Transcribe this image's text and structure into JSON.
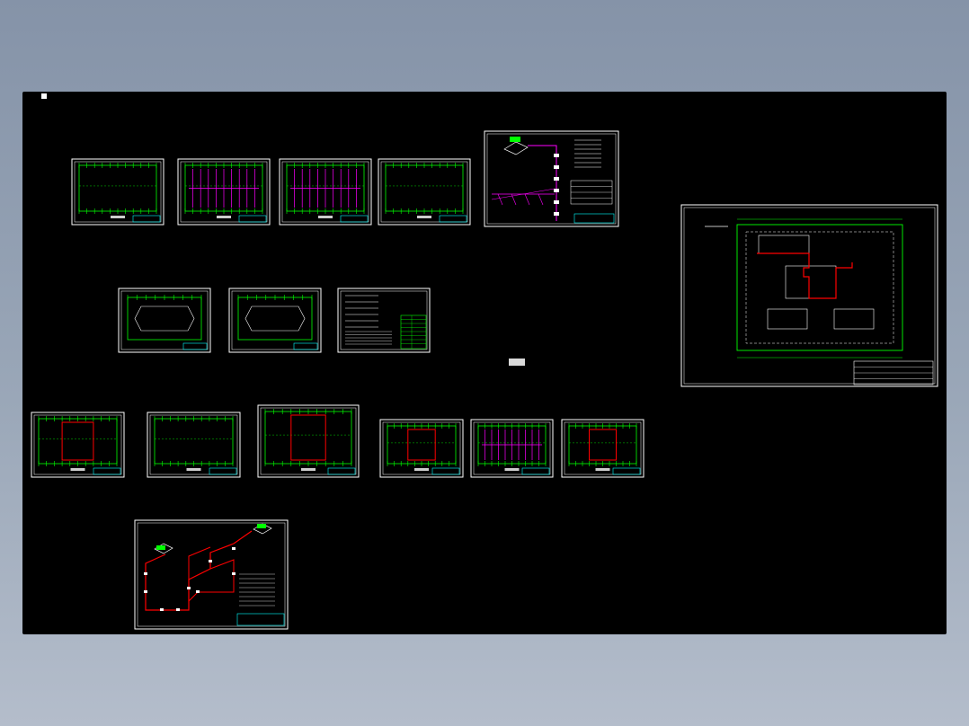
{
  "colors": {
    "background_gradient_top": "#8593a8",
    "viewport_background": "#000000",
    "frame": "#ffffff",
    "grid": "#00ff00",
    "pipe_red": "#ff0000",
    "pipe_magenta": "#ff00ff",
    "title_block": "#00ffff"
  },
  "sheets": [
    {
      "id": "floor-plan-1",
      "kind": "plan",
      "pipe": "none"
    },
    {
      "id": "floor-plan-2",
      "kind": "plan",
      "pipe": "magenta"
    },
    {
      "id": "floor-plan-3",
      "kind": "plan",
      "pipe": "magenta"
    },
    {
      "id": "floor-plan-4",
      "kind": "plan",
      "pipe": "none"
    },
    {
      "id": "system-diagram",
      "kind": "schematic",
      "pipe": "magenta"
    },
    {
      "id": "roof-plan-1",
      "kind": "roof",
      "pipe": "none"
    },
    {
      "id": "roof-plan-2",
      "kind": "roof",
      "pipe": "none"
    },
    {
      "id": "legend-sheet",
      "kind": "notes",
      "pipe": "none"
    },
    {
      "id": "fire-plan-1",
      "kind": "plan",
      "pipe": "red"
    },
    {
      "id": "fire-plan-2",
      "kind": "plan",
      "pipe": "none"
    },
    {
      "id": "fire-plan-3",
      "kind": "plan",
      "pipe": "red"
    },
    {
      "id": "drainage-plan-1",
      "kind": "plan",
      "pipe": "red"
    },
    {
      "id": "drainage-plan-2",
      "kind": "plan",
      "pipe": "magenta"
    },
    {
      "id": "drainage-plan-3",
      "kind": "plan",
      "pipe": "red"
    },
    {
      "id": "site-plan",
      "kind": "site",
      "pipe": "red"
    },
    {
      "id": "isometric-diagram",
      "kind": "isometric",
      "pipe": "red"
    }
  ]
}
